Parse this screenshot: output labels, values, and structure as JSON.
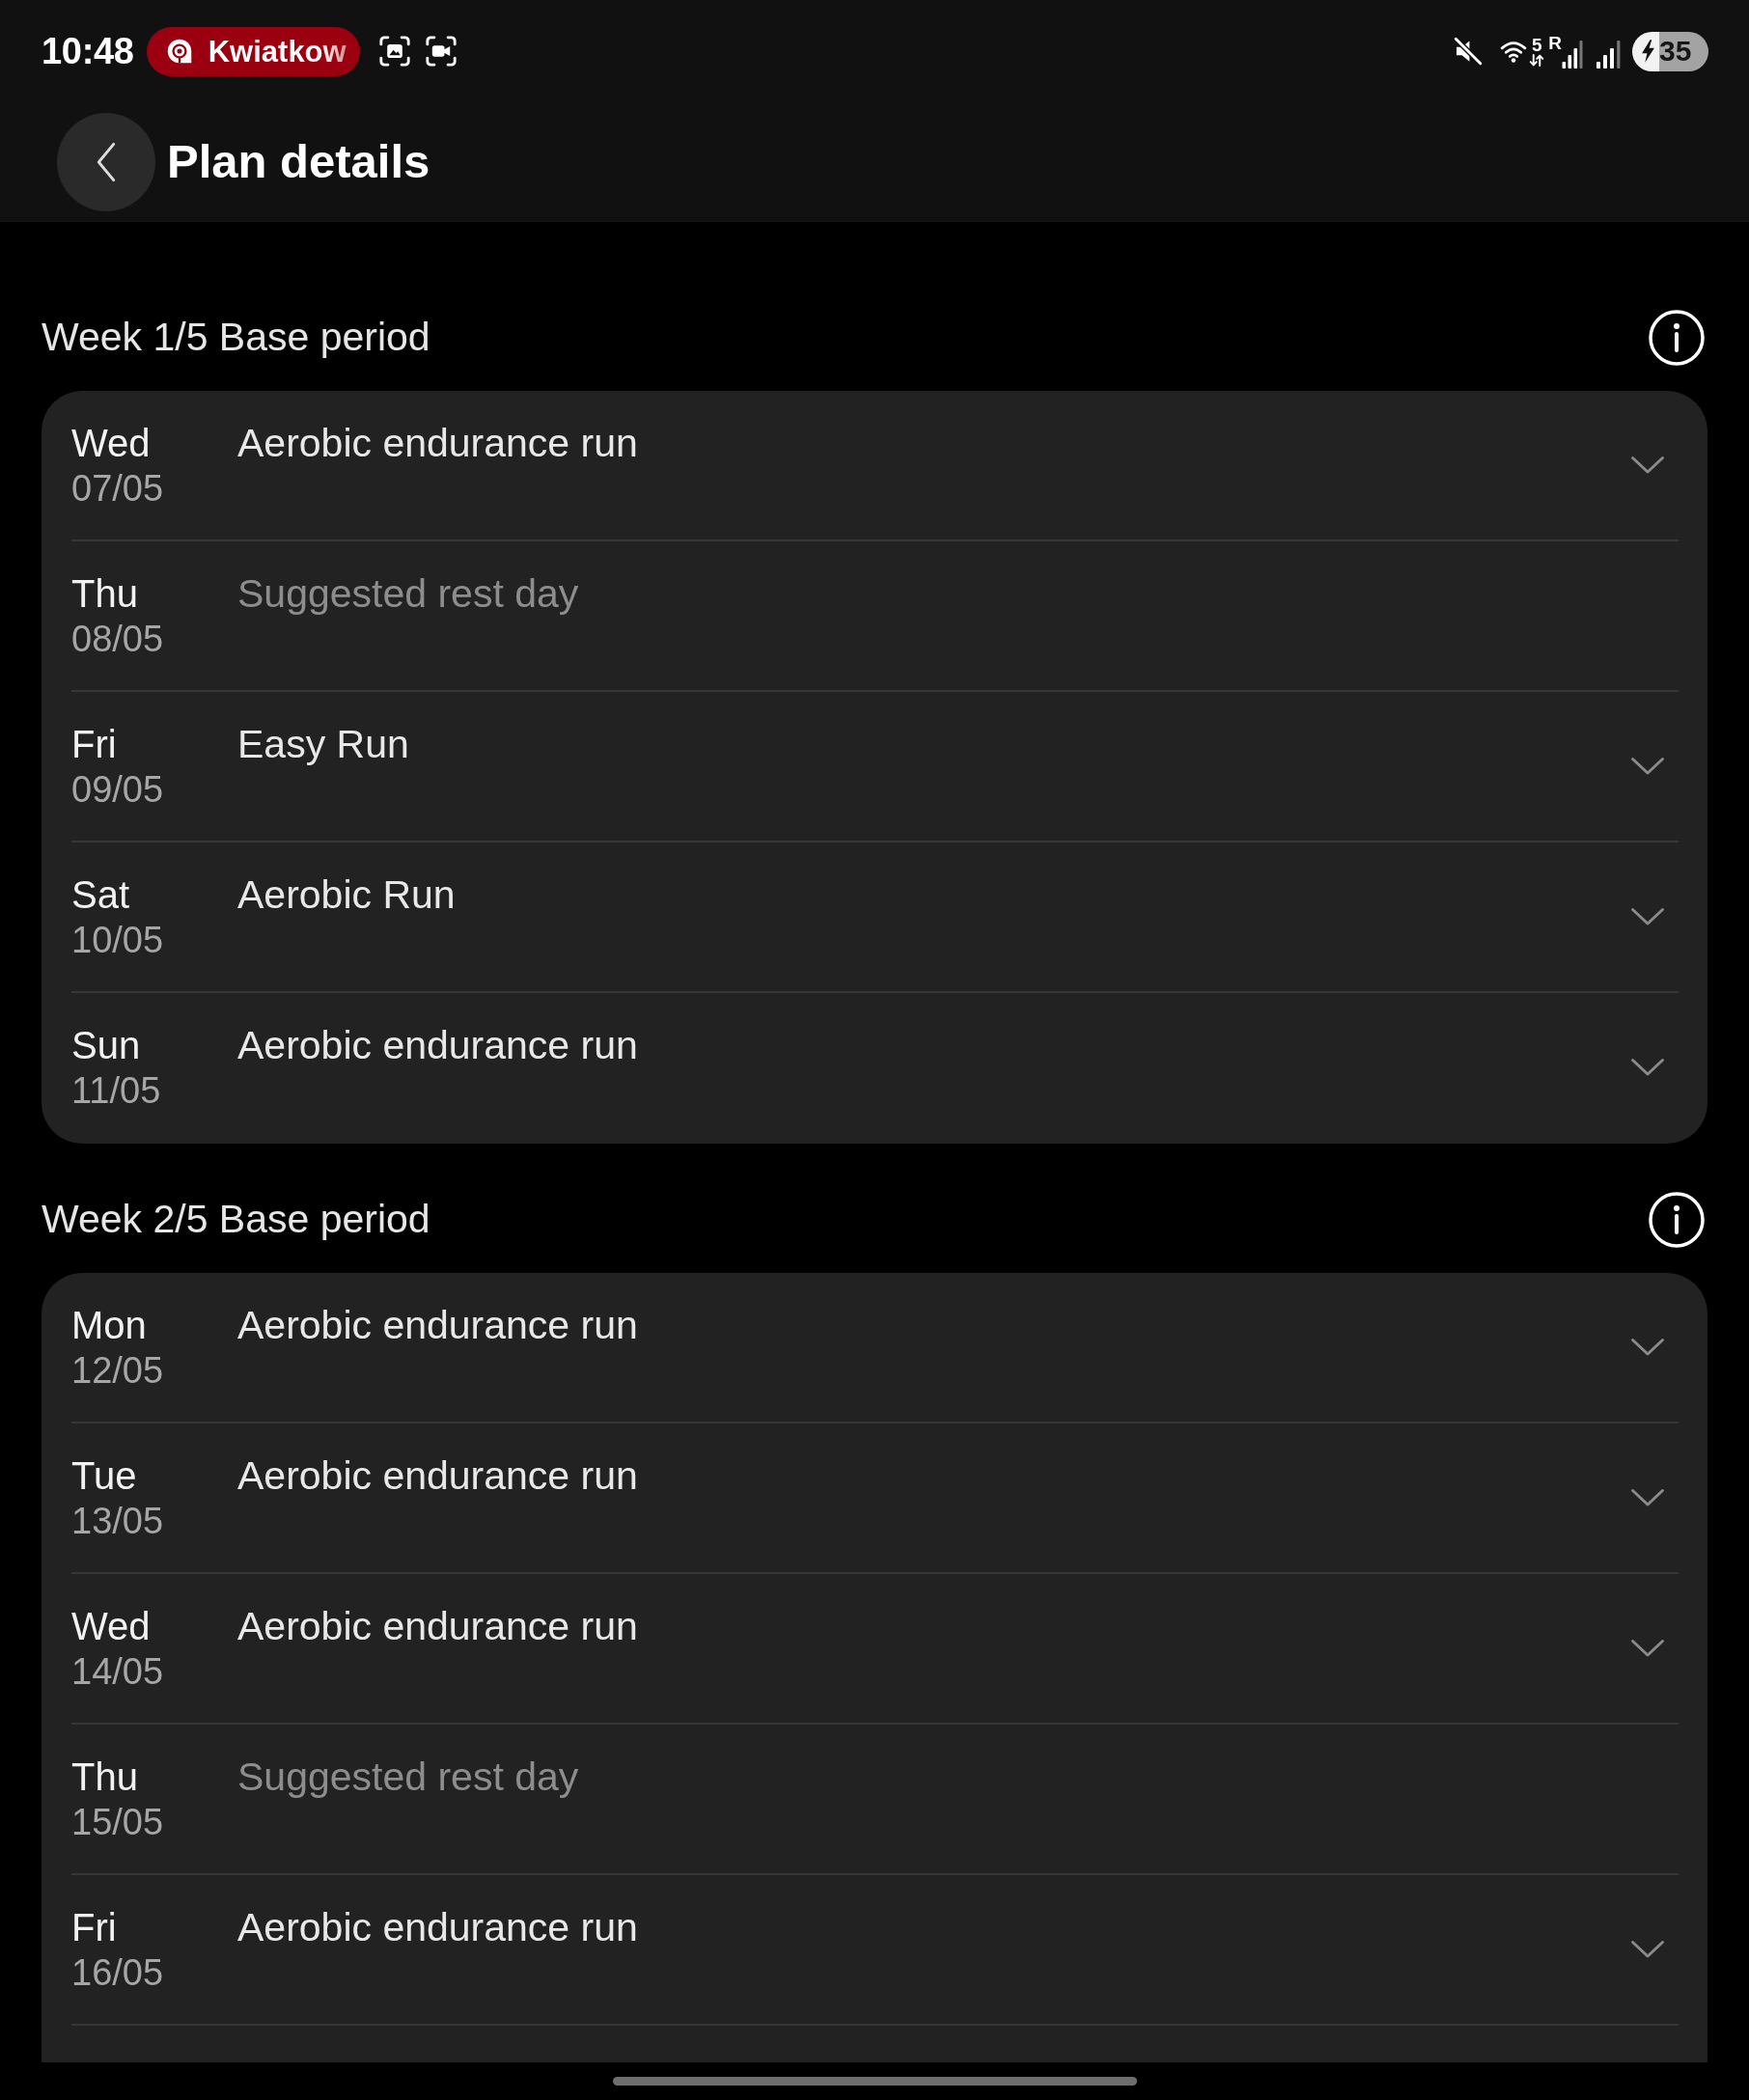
{
  "status_bar": {
    "time": "10:48",
    "media_chip": {
      "text": "Kwiatkow"
    },
    "wifi_band": "5",
    "roaming": "R",
    "battery": "35"
  },
  "header": {
    "title": "Plan details"
  },
  "weeks": [
    {
      "title": "Week 1/5 Base period",
      "continues_below": false,
      "days": [
        {
          "day": "Wed",
          "date": "07/05",
          "kind": "workout",
          "title": "Aerobic endurance run",
          "expanded": false
        },
        {
          "day": "Thu",
          "date": "08/05",
          "kind": "rest",
          "title": "Suggested rest day"
        },
        {
          "day": "Fri",
          "date": "09/05",
          "kind": "workout",
          "title": "Easy Run",
          "expanded": false
        },
        {
          "day": "Sat",
          "date": "10/05",
          "kind": "workout",
          "title": "Aerobic Run",
          "expanded": false
        },
        {
          "day": "Sun",
          "date": "11/05",
          "kind": "workout",
          "title": "Aerobic endurance run",
          "expanded": false
        }
      ]
    },
    {
      "title": "Week 2/5 Base period",
      "continues_below": true,
      "days": [
        {
          "day": "Mon",
          "date": "12/05",
          "kind": "workout",
          "title": "Aerobic endurance run",
          "expanded": false
        },
        {
          "day": "Tue",
          "date": "13/05",
          "kind": "workout",
          "title": "Aerobic endurance run",
          "expanded": false
        },
        {
          "day": "Wed",
          "date": "14/05",
          "kind": "workout",
          "title": "Aerobic endurance run",
          "expanded": false
        },
        {
          "day": "Thu",
          "date": "15/05",
          "kind": "rest",
          "title": "Suggested rest day"
        },
        {
          "day": "Fri",
          "date": "16/05",
          "kind": "workout",
          "title": "Aerobic endurance run",
          "expanded": false
        }
      ]
    }
  ]
}
